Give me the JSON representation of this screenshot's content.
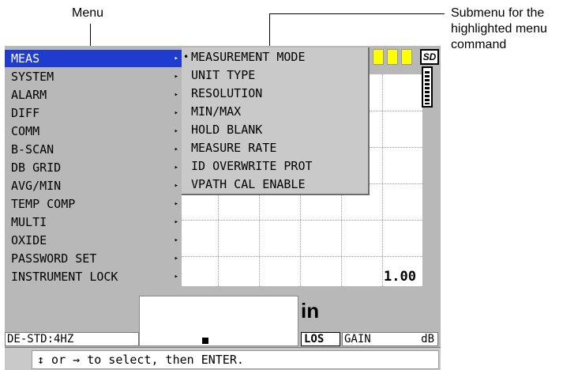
{
  "callouts": {
    "menu": "Menu",
    "submenu_line1": "Submenu for the",
    "submenu_line2": "highlighted menu",
    "submenu_line3": "command"
  },
  "menu": {
    "items": [
      {
        "label": "MEAS",
        "active": true
      },
      {
        "label": "SYSTEM"
      },
      {
        "label": "ALARM"
      },
      {
        "label": "DIFF"
      },
      {
        "label": "COMM"
      },
      {
        "label": "B-SCAN"
      },
      {
        "label": "DB GRID"
      },
      {
        "label": "AVG/MIN"
      },
      {
        "label": "TEMP COMP"
      },
      {
        "label": "MULTI"
      },
      {
        "label": "OXIDE"
      },
      {
        "label": "PASSWORD SET"
      },
      {
        "label": "INSTRUMENT LOCK"
      }
    ],
    "arrow": "▸"
  },
  "submenu": {
    "items": [
      "MEASUREMENT MODE",
      "UNIT TYPE",
      "RESOLUTION",
      "MIN/MAX",
      "HOLD BLANK",
      "MEASURE RATE",
      "ID OVERWRITE PROT",
      "VPATH CAL ENABLE"
    ],
    "bullet": "•"
  },
  "indicators": {
    "sd": "SD",
    "color": "#ffff00"
  },
  "readout": {
    "value": "1.00",
    "unit": "in"
  },
  "status": {
    "left": "DE-STD:4HZ",
    "los": "LOS",
    "gain": "GAIN",
    "gain_unit": "dB"
  },
  "help": {
    "text": "↕ or → to select, then ENTER."
  }
}
